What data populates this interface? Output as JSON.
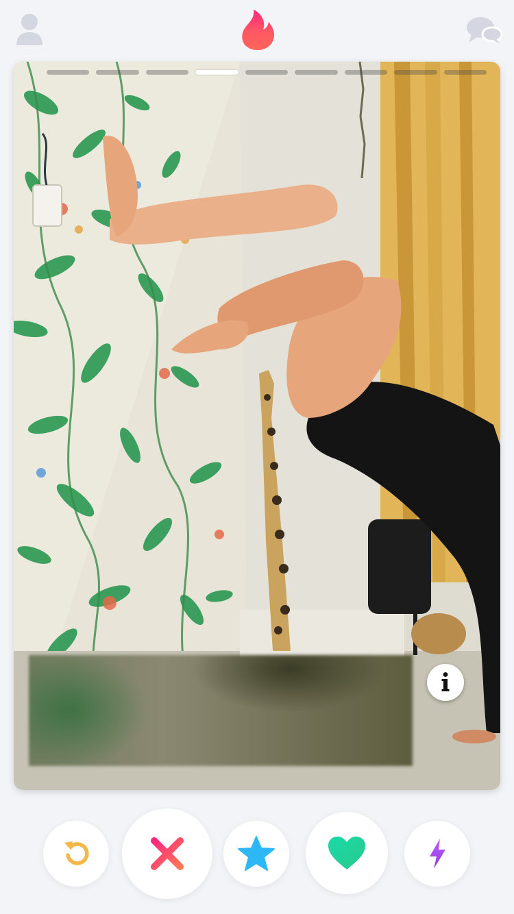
{
  "app": {
    "name": "Tinder",
    "brand_gradient": [
      "#fd297b",
      "#ff5864",
      "#ff655b"
    ]
  },
  "topbar": {
    "left_icon": "profile-icon",
    "center_icon": "flame-logo-icon",
    "right_icon": "messages-icon",
    "icon_color": "#d4d7df"
  },
  "card": {
    "photo_count": 9,
    "current_photo_index": 3,
    "profile_text_obscured": true,
    "info_icon": "info-icon"
  },
  "actions": [
    {
      "name": "rewind",
      "icon": "rewind-icon",
      "color": "#f5b748"
    },
    {
      "name": "nope",
      "icon": "x-icon",
      "color": "#fd4e6d"
    },
    {
      "name": "super-like",
      "icon": "star-icon",
      "color": "#2db8f5"
    },
    {
      "name": "like",
      "icon": "heart-icon",
      "color": "#20d5a0"
    },
    {
      "name": "boost",
      "icon": "lightning-icon",
      "color": "#a24cf0"
    }
  ]
}
